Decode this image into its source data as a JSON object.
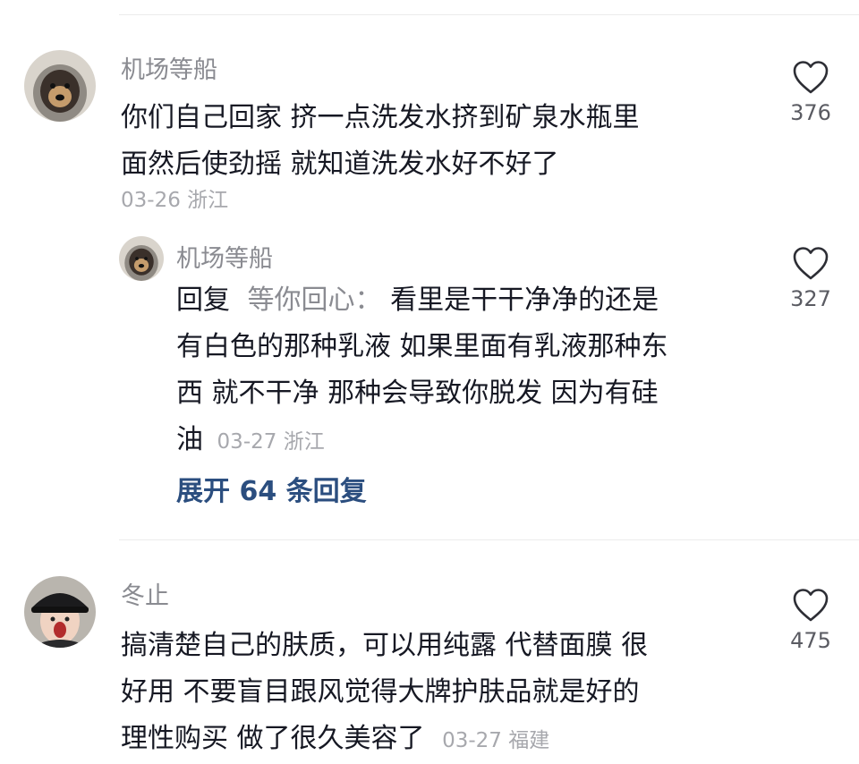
{
  "comments": [
    {
      "username": "机场等船",
      "lines": [
        "你们自己回家 挤一点洗发水挤到矿泉水瓶里",
        "面然后使劲摇 就知道洗发水好不好了"
      ],
      "meta": "03-26 浙江",
      "likes": "376",
      "avatar_icon": "dog-in-hood-avatar"
    },
    {
      "username": "冬止",
      "lines": [
        "搞清楚自己的肤质，可以用纯露 代替面膜 很",
        "好用 不要盲目跟风觉得大牌护肤品就是好的",
        "理性购买 做了很久美容了"
      ],
      "meta": "03-27 福建",
      "likes": "475",
      "avatar_icon": "person-in-hat-avatar"
    }
  ],
  "reply": {
    "username": "机场等船",
    "prefix": "回复",
    "target": "等你回心：",
    "lines": [
      "看里是干干净净的还是",
      "有白色的那种乳液 如果里面有乳液那种东",
      "西 就不干净 那种会导致你脱发 因为有硅",
      "油"
    ],
    "meta": "03-27 浙江",
    "likes": "327",
    "avatar_icon": "dog-in-hood-avatar"
  },
  "expand_replies": "展开 64 条回复",
  "icons": {
    "like": "heart-outline-icon"
  },
  "colors": {
    "text": "#161823",
    "secondary": "#8a8b91",
    "link": "#2b4e7f",
    "divider": "#ececec"
  }
}
